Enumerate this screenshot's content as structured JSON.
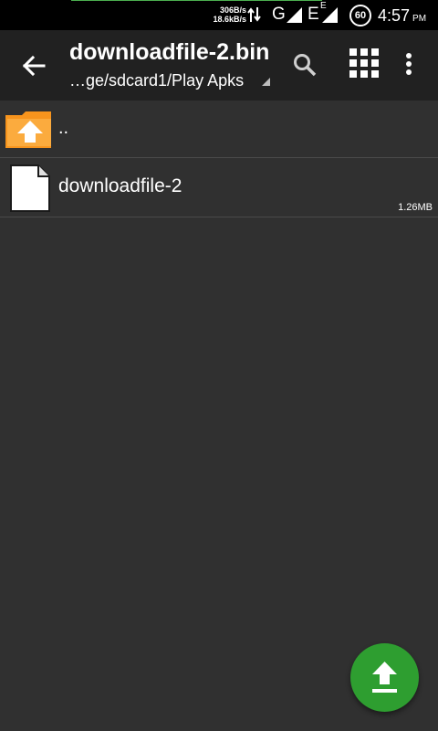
{
  "status_bar": {
    "upload_speed": "306B/s",
    "download_speed": "18.6kB/s",
    "network_1": "G",
    "network_2": "E",
    "network_2_small": "E",
    "battery_level": "60",
    "time": "4:57",
    "ampm": "PM",
    "icons": [
      "data-transfer-icon",
      "signal-icon",
      "signal-icon",
      "battery-icon"
    ]
  },
  "toolbar": {
    "title": "downloadfile-2.bin",
    "subtitle": "…ge/sdcard1/Play Apks",
    "icons": [
      "back-arrow-icon",
      "search-icon",
      "grid-view-icon",
      "more-vert-icon"
    ]
  },
  "list": {
    "parent_label": "..",
    "items": [
      {
        "name": "downloadfile-2",
        "size": "1.26MB",
        "icon": "file-icon"
      }
    ]
  },
  "fab": {
    "icon": "upload-icon"
  },
  "colors": {
    "background": "#303030",
    "toolbar": "#212121",
    "status_bar": "#000000",
    "folder_accent": "#f7941d",
    "fab": "#2e9e30",
    "status_line": "#4caf50"
  }
}
